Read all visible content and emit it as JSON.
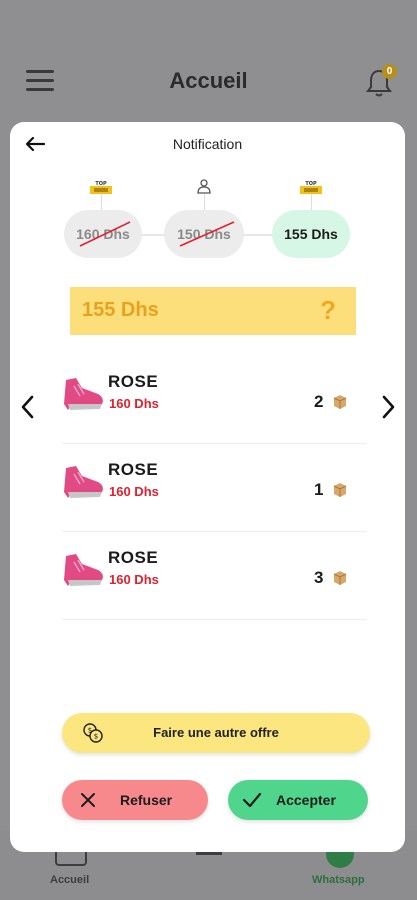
{
  "background": {
    "header_title": "Accueil",
    "notification_count": "0",
    "bottom_tabs": [
      {
        "label": "Accueil"
      },
      {
        "label": "Whatsapp"
      }
    ]
  },
  "modal": {
    "title": "Notification",
    "steps": [
      {
        "price": "160 Dhs",
        "struck": true,
        "icon": "top-vendor-badge-icon"
      },
      {
        "price": "150 Dhs",
        "struck": true,
        "icon": "user-icon"
      },
      {
        "price": "155 Dhs",
        "struck": false,
        "icon": "top-vendor-badge-icon"
      }
    ],
    "offer": {
      "price": "155 Dhs",
      "symbol": "?"
    },
    "items": [
      {
        "name": "ROSE",
        "price": "160 Dhs",
        "qty": "2"
      },
      {
        "name": "ROSE",
        "price": "160 Dhs",
        "qty": "1"
      },
      {
        "name": "ROSE",
        "price": "160 Dhs",
        "qty": "3"
      }
    ],
    "buttons": {
      "other_offer": "Faire une autre offre",
      "refuse": "Refuser",
      "accept": "Accepter"
    }
  },
  "colors": {
    "accent_yellow": "#fcdf7a",
    "price_red": "#e0212f",
    "accept_green": "#4fd58c",
    "refuse_red": "#f7898c",
    "current_step": "#d7f7e6"
  }
}
